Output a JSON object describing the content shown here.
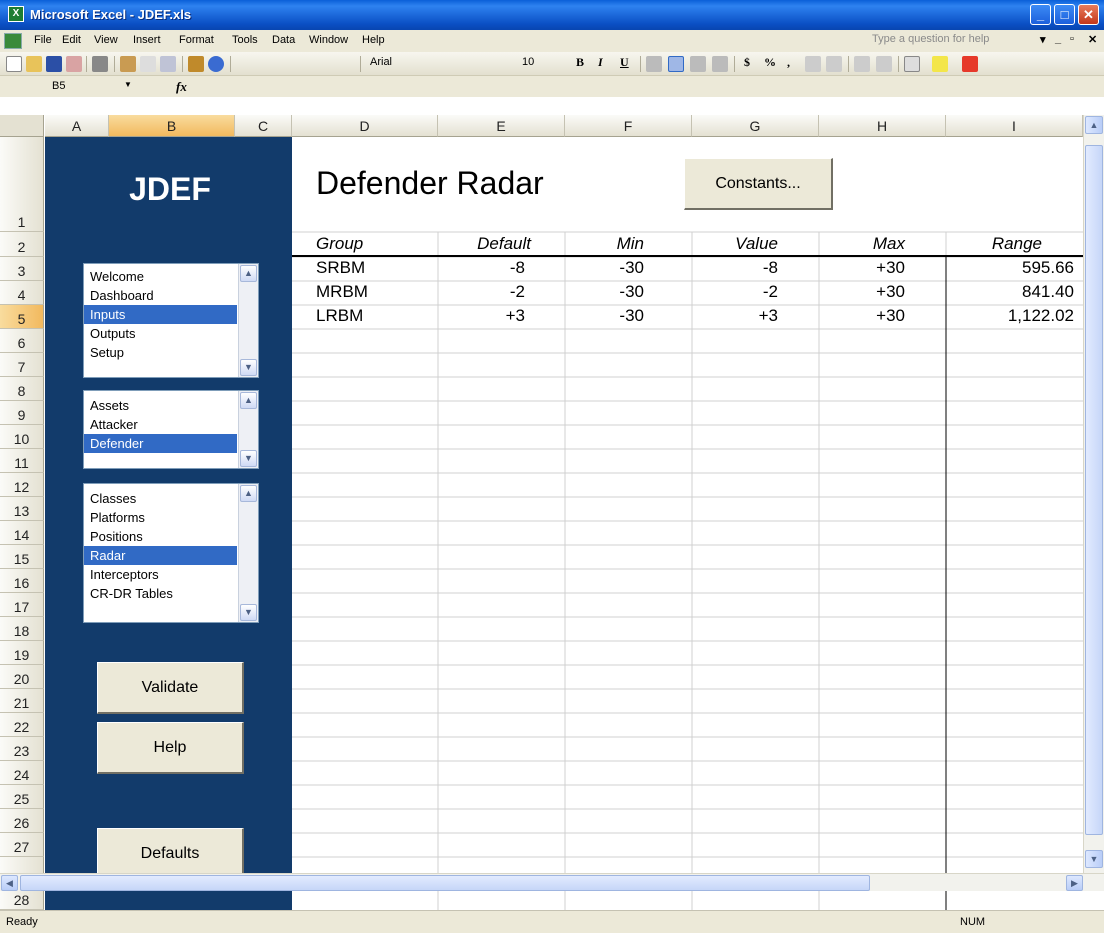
{
  "window": {
    "title": "Microsoft Excel - JDEF.xls"
  },
  "menu": [
    "File",
    "Edit",
    "View",
    "Insert",
    "Format",
    "Tools",
    "Data",
    "Window",
    "Help"
  ],
  "help_placeholder": "Type a question for help",
  "toolbar": {
    "font": "Arial",
    "size": "10",
    "bold": "B",
    "italic": "I",
    "underline": "U",
    "currency": "$",
    "percent": "%",
    "comma": ","
  },
  "formula": {
    "name_box": "B5",
    "fx": "fx",
    "content": ""
  },
  "columns": [
    "A",
    "B",
    "C",
    "D",
    "E",
    "F",
    "G",
    "H",
    "I"
  ],
  "rows": [
    "1",
    "2",
    "3",
    "4",
    "5",
    "6",
    "7",
    "8",
    "9",
    "10",
    "11",
    "12",
    "13",
    "14",
    "15",
    "16",
    "17",
    "18",
    "19",
    "20",
    "21",
    "22",
    "23",
    "24",
    "25",
    "26",
    "27",
    "28"
  ],
  "nav": {
    "logo": "JDEF",
    "list1": {
      "items": [
        "Welcome",
        "Dashboard",
        "Inputs",
        "Outputs",
        "Setup"
      ],
      "selected": 2
    },
    "list2": {
      "items": [
        "Assets",
        "Attacker",
        "Defender"
      ],
      "selected": 2
    },
    "list3": {
      "items": [
        "Classes",
        "Platforms",
        "Positions",
        "Radar",
        "Interceptors",
        "CR-DR Tables"
      ],
      "selected": 3
    },
    "validate": "Validate",
    "help": "Help",
    "defaults": "Defaults"
  },
  "page": {
    "heading": "Defender Radar",
    "constants_button": "Constants..."
  },
  "table": {
    "headers": [
      "Group",
      "Default",
      "Min",
      "Value",
      "Max",
      "Range"
    ],
    "rows": [
      [
        "SRBM",
        "-8",
        "-30",
        "-8",
        "+30",
        "595.66"
      ],
      [
        "MRBM",
        "-2",
        "-30",
        "-2",
        "+30",
        "841.40"
      ],
      [
        "LRBM",
        "+3",
        "-30",
        "+3",
        "+30",
        "1,122.02"
      ]
    ]
  },
  "status": {
    "left": "Ready",
    "right": "NUM"
  },
  "colors": {
    "nav_bg": "#123b6b",
    "selection": "#316ac5",
    "title_bar": "#0a5fd8"
  }
}
